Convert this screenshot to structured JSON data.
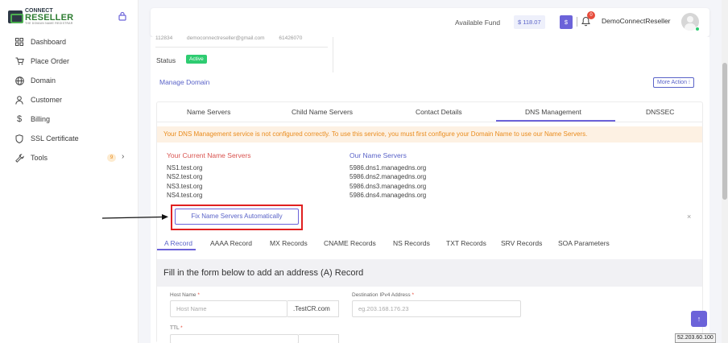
{
  "brand": {
    "logo_top": "CONNECT",
    "logo_main": "RESELLER",
    "logo_sub": "THE DOMAIN NAME REGISTRAR"
  },
  "sidebar": {
    "items": [
      {
        "label": "Dashboard",
        "icon": "grid-icon"
      },
      {
        "label": "Place Order",
        "icon": "cart-icon"
      },
      {
        "label": "Domain",
        "icon": "globe-icon"
      },
      {
        "label": "Customer",
        "icon": "user-icon"
      },
      {
        "label": "Billing",
        "icon": "dollar-icon"
      },
      {
        "label": "SSL Certificate",
        "icon": "shield-icon"
      },
      {
        "label": "Tools",
        "icon": "wrench-icon",
        "badge": "9"
      }
    ]
  },
  "header": {
    "fund_label": "Available Fund",
    "fund_value": "$ 118.07",
    "dollar_button": "$",
    "notification_count": "0",
    "user_name": "DemoConnectReseller"
  },
  "domain_info": {
    "id": "112834",
    "email": "democonnectreseller@gmail.com",
    "phone": "61426070",
    "status_label": "Status",
    "status_value": "Active"
  },
  "manage": {
    "title": "Manage Domain",
    "more_action": "More Action ⁝"
  },
  "tabs": [
    "Name Servers",
    "Child Name Servers",
    "Contact Details",
    "DNS Management",
    "DNSSEC"
  ],
  "active_tab": "DNS Management",
  "warning": "Your DNS Management service is not configured correctly. To use this service, you must first configure your Domain Name to use our Name Servers.",
  "current_ns": {
    "heading": "Your Current Name Servers",
    "list": [
      "NS1.test.org",
      "NS2.test.org",
      "NS3.test.org",
      "NS4.test.org"
    ]
  },
  "our_ns": {
    "heading": "Our Name Servers",
    "list": [
      "5986.dns1.managedns.org",
      "5986.dns2.managedns.org",
      "5986.dns3.managedns.org",
      "5986.dns4.managedns.org"
    ]
  },
  "fix_button": "Fix Name Servers Automatically",
  "record_tabs": [
    "A Record",
    "AAAA Record",
    "MX Records",
    "CNAME Records",
    "NS Records",
    "TXT Records",
    "SRV Records",
    "SOA Parameters"
  ],
  "active_record_tab": "A Record",
  "form": {
    "title": "Fill in the form below to add an address (A) Record",
    "host_label": "Host Name",
    "host_placeholder": "Host Name",
    "host_suffix": ".TestCR.com",
    "dest_label": "Destination IPv4 Address",
    "dest_placeholder": "eg.203.168.176.23",
    "ttl_label": "TTL",
    "required_mark": "*"
  },
  "ip_badge": "52.203.60.100",
  "colors": {
    "accent": "#6c63d9",
    "warning_bg": "#fdf1e3",
    "warning_text": "#e98b1c",
    "active_green": "#2ecc71",
    "annotation_red": "#e02020"
  }
}
